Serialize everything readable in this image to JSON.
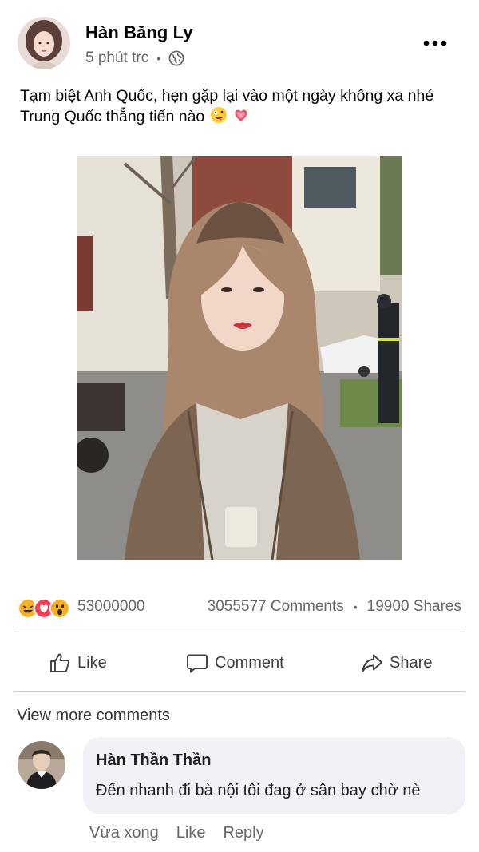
{
  "post": {
    "author_name": "Hàn Băng Ly",
    "timestamp": "5 phút trc",
    "separator": "•",
    "privacy_icon": "globe-icon",
    "more_icon": "more-horizontal-icon",
    "caption_line1": "Tạm biệt Anh Quốc, hẹn gặp lại vào một ngày không xa nhé",
    "caption_line2": "Trung Quốc thẳng tiến nào",
    "caption_emojis": [
      "zany-face-emoji",
      "sparkling-heart-emoji"
    ],
    "photo_alt": "photo"
  },
  "stats": {
    "reactions": [
      "haha",
      "love",
      "wow"
    ],
    "reaction_count": "53000000",
    "comments": "3055577 Comments",
    "separator": "•",
    "shares": "19900 Shares"
  },
  "actions": {
    "like": "Like",
    "comment": "Comment",
    "share": "Share"
  },
  "comments": {
    "view_more": "View more comments",
    "items": [
      {
        "name": "Hàn Thần Thần",
        "text": "Đến nhanh đi bà nội tôi đag ở sân bay chờ nè",
        "time": "Vừa xong",
        "like": "Like",
        "reply": "Reply"
      }
    ]
  },
  "colors": {
    "text_primary": "#050505",
    "text_secondary": "#65676b",
    "divider": "#ced0d4",
    "bubble": "#f0f2f5",
    "haha": "#f7b125",
    "love": "#f33e58"
  }
}
